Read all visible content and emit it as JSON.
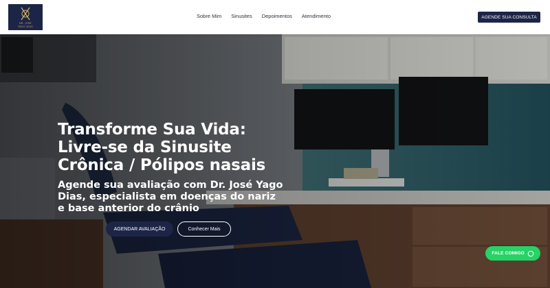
{
  "brand": {
    "logo_text_line1": "DR. JOSÉ",
    "logo_text_line2": "YAGO DIAS",
    "accent": "#1d2547",
    "gold": "#cfae6a"
  },
  "nav": {
    "items": [
      "Sobre Mim",
      "Sinusites",
      "Depoimentos",
      "Atendimento"
    ]
  },
  "header_cta": "AGENDE SUA CONSULTA",
  "hero": {
    "title": "Transforme Sua Vida: Livre-se da Sinusite Crônica / Pólipos nasais",
    "subtitle": "Agende sua avaliação com Dr. José Yago Dias, especialista em doenças do nariz e base anterior do crânio",
    "primary_button": "AGENDAR AVALIAÇÃO",
    "secondary_button": "Conhecer Mais"
  },
  "whatsapp_button": "FALE COMIGO",
  "icons": {
    "whatsapp": "whatsapp-icon",
    "logo": "logo-monogram-icon"
  }
}
